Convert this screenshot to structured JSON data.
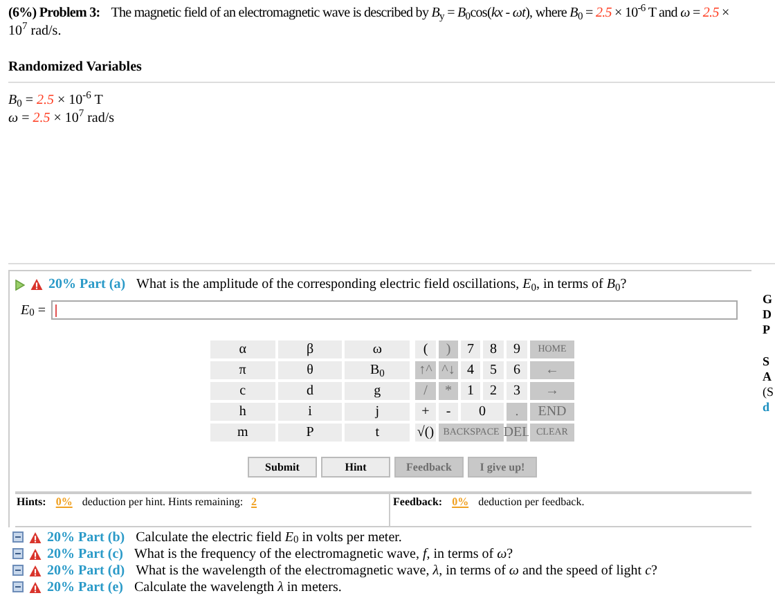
{
  "problem": {
    "label": "(6%)  Problem 3:",
    "lines": [
      [
        {
          "kind": "text",
          "text": "The magnetic field of an electromagnetic wave is described by *B*$_{y}$ = *B*$_{0}$cos(*kx* - *ωt*), where *B*$_{0}$ = "
        },
        {
          "kind": "value",
          "text": "2.5"
        },
        {
          "kind": "text",
          "text": " × 10$^{-6}$ T and *ω* = "
        },
        {
          "kind": "value",
          "text": "2.5"
        },
        {
          "kind": "text",
          "text": " ×"
        }
      ],
      [
        {
          "kind": "text",
          "text": "10$^{7}$ rad/s."
        }
      ]
    ]
  },
  "randomized": {
    "title": "Randomized Variables",
    "lines": [
      [
        {
          "kind": "text",
          "text": "*B*$_{0}$ = "
        },
        {
          "kind": "value",
          "text": "2.5"
        },
        {
          "kind": "text",
          "text": " × 10$^{-6}$ T"
        }
      ],
      [
        {
          "kind": "text",
          "text": "*ω* = "
        },
        {
          "kind": "value",
          "text": "2.5"
        },
        {
          "kind": "text",
          "text": " × 10$^{7}$ rad/s"
        }
      ]
    ]
  },
  "part_a": {
    "weight": "20% Part (a)",
    "question": "What is the amplitude of the corresponding electric field oscillations, *E*$_{0}$, in terms of *B*$_{0}$?",
    "field_label": "*E*$_{0}$ =",
    "symbols": [
      [
        "α",
        "β",
        "ω"
      ],
      [
        "π",
        "θ",
        "B$_{0}$"
      ],
      [
        "c",
        "d",
        "g"
      ],
      [
        "h",
        "i",
        "j"
      ],
      [
        "m",
        "P",
        "t"
      ]
    ],
    "keys": [
      [
        {
          "label": "(",
          "disabled": false,
          "kind": "single"
        },
        {
          "label": ")",
          "disabled": true,
          "kind": "single"
        },
        {
          "label": "7",
          "disabled": false,
          "kind": "single"
        },
        {
          "label": "8",
          "disabled": false,
          "kind": "single"
        },
        {
          "label": "9",
          "disabled": false,
          "kind": "single"
        },
        {
          "label": "HOME",
          "disabled": true,
          "kind": "single"
        }
      ],
      [
        {
          "label": "↑^",
          "disabled": true,
          "kind": "single"
        },
        {
          "label": "^↓",
          "disabled": true,
          "kind": "single"
        },
        {
          "label": "4",
          "disabled": false,
          "kind": "single"
        },
        {
          "label": "5",
          "disabled": false,
          "kind": "single"
        },
        {
          "label": "6",
          "disabled": false,
          "kind": "single"
        },
        {
          "label": "←",
          "disabled": true,
          "kind": "single"
        }
      ],
      [
        {
          "label": "/",
          "disabled": true,
          "kind": "single"
        },
        {
          "label": "*",
          "disabled": true,
          "kind": "single"
        },
        {
          "label": "1",
          "disabled": false,
          "kind": "single"
        },
        {
          "label": "2",
          "disabled": false,
          "kind": "single"
        },
        {
          "label": "3",
          "disabled": false,
          "kind": "single"
        },
        {
          "label": "→",
          "disabled": true,
          "kind": "single"
        }
      ],
      [
        {
          "label": "+",
          "disabled": false,
          "kind": "single"
        },
        {
          "label": "-",
          "disabled": false,
          "kind": "single"
        },
        {
          "label": "0",
          "disabled": false,
          "kind": "double"
        },
        {
          "label": ".",
          "disabled": true,
          "kind": "single"
        },
        {
          "label": "END",
          "disabled": true,
          "kind": "single"
        }
      ],
      [
        {
          "label": "√()",
          "disabled": false,
          "kind": "single"
        },
        {
          "label": "BACKSPACE",
          "disabled": true,
          "kind": "triple"
        },
        {
          "label": "DEL",
          "disabled": true,
          "kind": "single"
        },
        {
          "label": "CLEAR",
          "disabled": true,
          "kind": "single"
        }
      ]
    ],
    "buttons": [
      {
        "label": "Submit",
        "disabled": false
      },
      {
        "label": "Hint",
        "disabled": false
      },
      {
        "label": "Feedback",
        "disabled": true
      },
      {
        "label": "I give up!",
        "disabled": true
      }
    ]
  },
  "hints": {
    "label": "Hints:",
    "deduction": "0%",
    "text": "deduction per hint. Hints remaining:",
    "remaining": "2"
  },
  "feedback": {
    "label": "Feedback:",
    "deduction": "0%",
    "text": "deduction per feedback."
  },
  "parts": [
    {
      "weight": "20% Part (b)",
      "question": "Calculate the electric field *E*$_{0}$ in volts per meter."
    },
    {
      "weight": "20% Part (c)",
      "question": "What is the frequency of the electromagnetic wave, *f*, in terms of *ω*?"
    },
    {
      "weight": "20% Part (d)",
      "question": "What is the wavelength of the electromagnetic wave, *λ*, in terms of *ω* and the speed of light *c*?"
    },
    {
      "weight": "20% Part (e)",
      "question": "Calculate the wavelength *λ* in meters."
    }
  ],
  "side_column": [
    {
      "kind": "bold",
      "text": "G"
    },
    {
      "kind": "bold",
      "text": "D"
    },
    {
      "kind": "bold",
      "text": "P"
    },
    {
      "kind": "gap",
      "text": "S"
    },
    {
      "kind": "bold",
      "text": "A"
    },
    {
      "kind": "note",
      "text": "(S"
    },
    {
      "kind": "link",
      "text": "d"
    }
  ]
}
